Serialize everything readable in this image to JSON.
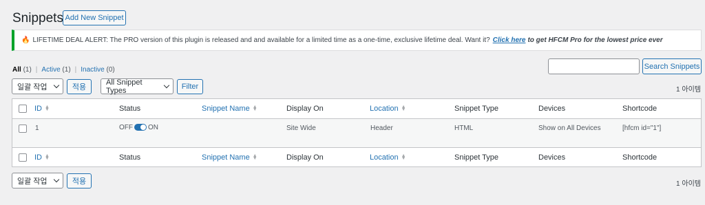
{
  "page": {
    "title": "Snippets",
    "add_new_label": "Add New Snippet"
  },
  "notice": {
    "icon": "fire-icon",
    "text": "LIFETIME DEAL ALERT: The PRO version of this plugin is released and and available for a limited time as a one-time, exclusive lifetime deal. Want it?",
    "link_text": "Click here",
    "tail_text": "to get HFCM Pro for the lowest price ever",
    "accent_color": "#00a32a"
  },
  "filters": {
    "all_label": "All",
    "all_count": "(1)",
    "active_label": "Active",
    "active_count": "(1)",
    "inactive_label": "Inactive",
    "inactive_count": "(0)"
  },
  "search": {
    "value": "",
    "button_label": "Search Snippets"
  },
  "top_controls": {
    "bulk_action_value": "일괄 작업",
    "apply_label": "적용",
    "type_filter_value": "All Snippet Types",
    "filter_label": "Filter",
    "items_count": "1 아이템"
  },
  "bottom_controls": {
    "bulk_action_value": "일괄 작업",
    "apply_label": "적용",
    "items_count": "1 아이템"
  },
  "table": {
    "columns": [
      "ID",
      "Status",
      "Snippet Name",
      "Display On",
      "Location",
      "Snippet Type",
      "Devices",
      "Shortcode"
    ],
    "rows": [
      {
        "id": "1",
        "status_off": "OFF",
        "status_on": "ON",
        "status_enabled": true,
        "snippet_name": "",
        "display_on": "Site Wide",
        "location": "Header",
        "snippet_type": "HTML",
        "devices": "Show on All Devices",
        "shortcode": "[hfcm id=\"1\"]"
      }
    ]
  },
  "colors": {
    "link": "#2271b1",
    "background": "#f0f0f1"
  }
}
